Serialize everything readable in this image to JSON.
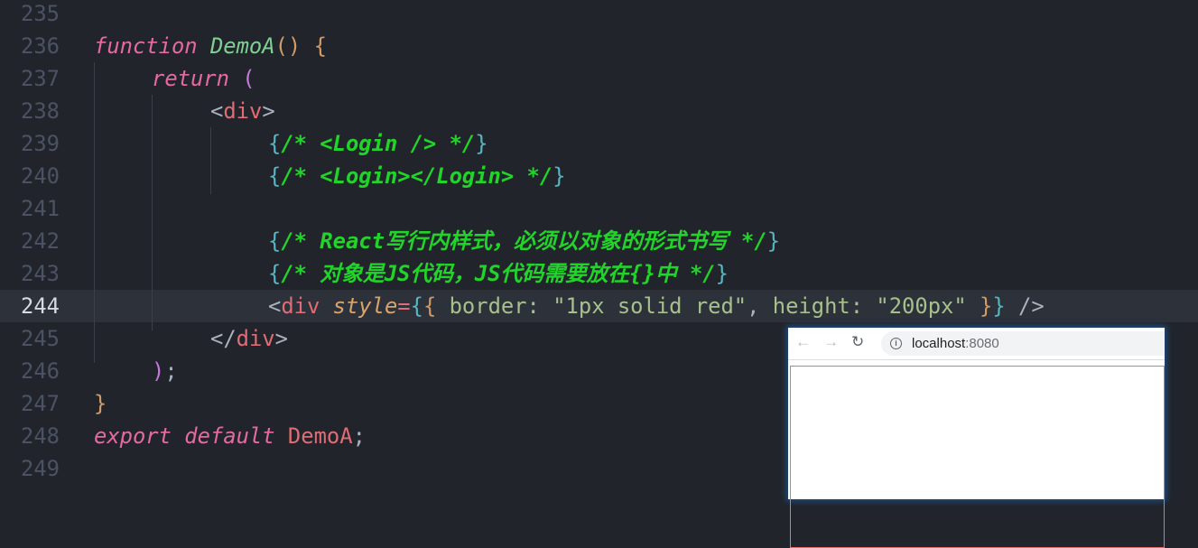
{
  "editor": {
    "active_line": 244,
    "lines": [
      {
        "n": "235",
        "indent": 0,
        "tokens": []
      },
      {
        "n": "236",
        "indent": 0,
        "tokens": [
          [
            "function",
            "#e46aa0",
            1
          ],
          [
            " ",
            "#abb2bf",
            0
          ],
          [
            "DemoA",
            "#7fd193",
            1
          ],
          [
            "()",
            "#d19a66",
            0
          ],
          [
            " ",
            "#abb2bf",
            0
          ],
          [
            "{",
            "#d19a66",
            0
          ]
        ]
      },
      {
        "n": "237",
        "indent": 1,
        "tokens": [
          [
            "return",
            "#e46aa0",
            1
          ],
          [
            " ",
            "#abb2bf",
            0
          ],
          [
            "(",
            "#c678dd",
            0
          ]
        ]
      },
      {
        "n": "238",
        "indent": 2,
        "tokens": [
          [
            "<",
            "#abb2bf",
            0
          ],
          [
            "div",
            "#e06c75",
            0
          ],
          [
            ">",
            "#abb2bf",
            0
          ]
        ]
      },
      {
        "n": "239",
        "indent": 3,
        "tokens": [
          [
            "{",
            "#56b6c2",
            0
          ],
          [
            "/* <Login /> */",
            "#22d32a",
            2
          ],
          [
            "}",
            "#56b6c2",
            0
          ]
        ]
      },
      {
        "n": "240",
        "indent": 3,
        "tokens": [
          [
            "{",
            "#56b6c2",
            0
          ],
          [
            "/* <Login></Login> */",
            "#22d32a",
            2
          ],
          [
            "}",
            "#56b6c2",
            0
          ]
        ]
      },
      {
        "n": "241",
        "indent": 0,
        "tokens": []
      },
      {
        "n": "242",
        "indent": 3,
        "tokens": [
          [
            "{",
            "#56b6c2",
            0
          ],
          [
            "/* React写行内样式，必须以对象的形式书写 */",
            "#22d32a",
            2
          ],
          [
            "}",
            "#56b6c2",
            0
          ]
        ]
      },
      {
        "n": "243",
        "indent": 3,
        "tokens": [
          [
            "{",
            "#56b6c2",
            0
          ],
          [
            "/* 对象是JS代码，JS代码需要放在{}中 */",
            "#22d32a",
            2
          ],
          [
            "}",
            "#56b6c2",
            0
          ]
        ]
      },
      {
        "n": "244",
        "indent": 3,
        "tokens": [
          [
            "<",
            "#abb2bf",
            0
          ],
          [
            "div",
            "#e06c75",
            0
          ],
          [
            " ",
            "#abb2bf",
            0
          ],
          [
            "style",
            "#d8a46a",
            1
          ],
          [
            "=",
            "#e06c75",
            0
          ],
          [
            "{",
            "#56b6c2",
            0
          ],
          [
            "{",
            "#d19a66",
            0
          ],
          [
            " border: ",
            "#a7c08c",
            0
          ],
          [
            "\"1px solid red\"",
            "#a7c08c",
            0
          ],
          [
            ", ",
            "#abb2bf",
            0
          ],
          [
            "height: ",
            "#a7c08c",
            0
          ],
          [
            "\"200px\"",
            "#a7c08c",
            0
          ],
          [
            " ",
            "#abb2bf",
            0
          ],
          [
            "}",
            "#d19a66",
            0
          ],
          [
            "}",
            "#56b6c2",
            0
          ],
          [
            " />",
            "#abb2bf",
            0
          ]
        ]
      },
      {
        "n": "245",
        "indent": 2,
        "tokens": [
          [
            "</",
            "#abb2bf",
            0
          ],
          [
            "div",
            "#e06c75",
            0
          ],
          [
            ">",
            "#abb2bf",
            0
          ]
        ]
      },
      {
        "n": "246",
        "indent": 1,
        "tokens": [
          [
            ")",
            "#c678dd",
            0
          ],
          [
            ";",
            "#abb2bf",
            0
          ]
        ]
      },
      {
        "n": "247",
        "indent": 0,
        "tokens": [
          [
            "}",
            "#d19a66",
            0
          ]
        ]
      },
      {
        "n": "248",
        "indent": 0,
        "tokens": [
          [
            "export",
            "#e46aa0",
            1
          ],
          [
            " ",
            "#abb2bf",
            0
          ],
          [
            "default",
            "#e46aa0",
            1
          ],
          [
            " ",
            "#abb2bf",
            0
          ],
          [
            "DemoA",
            "#e06c75",
            0
          ],
          [
            ";",
            "#abb2bf",
            0
          ]
        ]
      },
      {
        "n": "249",
        "indent": 0,
        "tokens": []
      }
    ]
  },
  "browser": {
    "back_icon": "arrow-left-icon",
    "forward_icon": "arrow-right-icon",
    "reload_icon": "reload-icon",
    "url_host": "localhost",
    "url_port": ":8080",
    "border_color": "#f36b6b"
  }
}
